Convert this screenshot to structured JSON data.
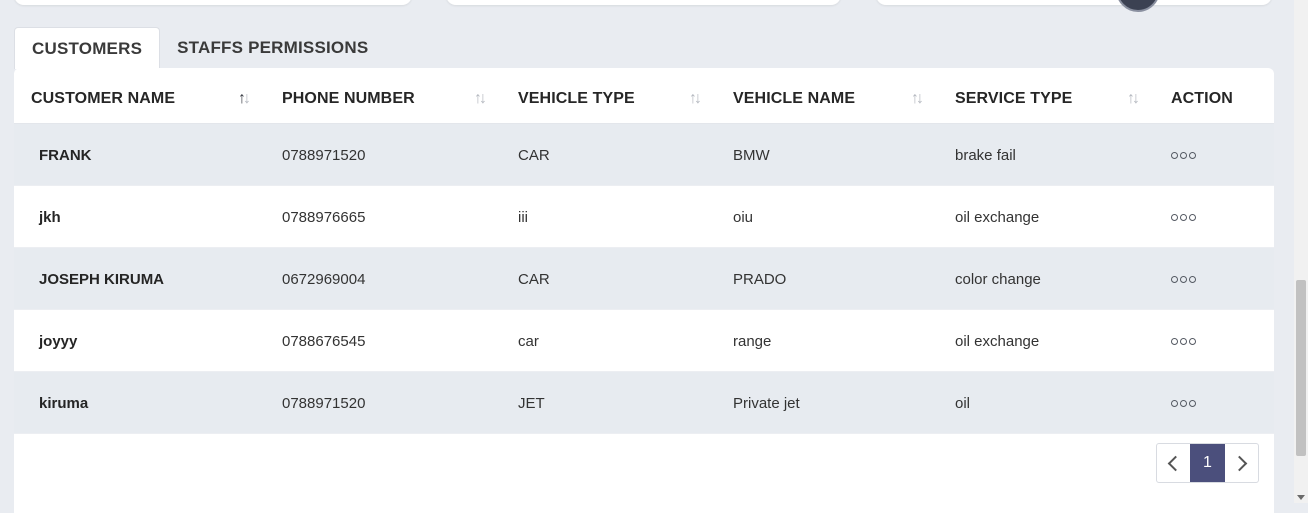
{
  "tabs": [
    {
      "label": "CUSTOMERS",
      "active": true
    },
    {
      "label": "STAFFS PERMISSIONS",
      "active": false
    }
  ],
  "table": {
    "columns": [
      "CUSTOMER NAME",
      "PHONE NUMBER",
      "VEHICLE TYPE",
      "VEHICLE NAME",
      "SERVICE TYPE",
      "ACTION"
    ],
    "sort_icon": "sort-arrows-icon",
    "rows": [
      {
        "customer_name": "FRANK",
        "phone_number": "0788971520",
        "vehicle_type": "CAR",
        "vehicle_name": "BMW",
        "service_type": "brake fail"
      },
      {
        "customer_name": "jkh",
        "phone_number": "0788976665",
        "vehicle_type": "iii",
        "vehicle_name": "oiu",
        "service_type": "oil exchange"
      },
      {
        "customer_name": "JOSEPH KIRUMA",
        "phone_number": "0672969004",
        "vehicle_type": "CAR",
        "vehicle_name": "PRADO",
        "service_type": "color change"
      },
      {
        "customer_name": "joyyy",
        "phone_number": "0788676545",
        "vehicle_type": "car",
        "vehicle_name": "range",
        "service_type": "oil exchange"
      },
      {
        "customer_name": "kiruma",
        "phone_number": "0788971520",
        "vehicle_type": "JET",
        "vehicle_name": "Private jet",
        "service_type": "oil"
      }
    ],
    "action_icon": "more-options-icon"
  },
  "pagination": {
    "current_page": "1",
    "prev_icon": "chevron-left-icon",
    "next_icon": "chevron-right-icon"
  },
  "colors": {
    "page_bg": "#e9ecf1",
    "row_alt_bg": "#e7ebf0",
    "pager_active_bg": "#4b4f7c"
  }
}
